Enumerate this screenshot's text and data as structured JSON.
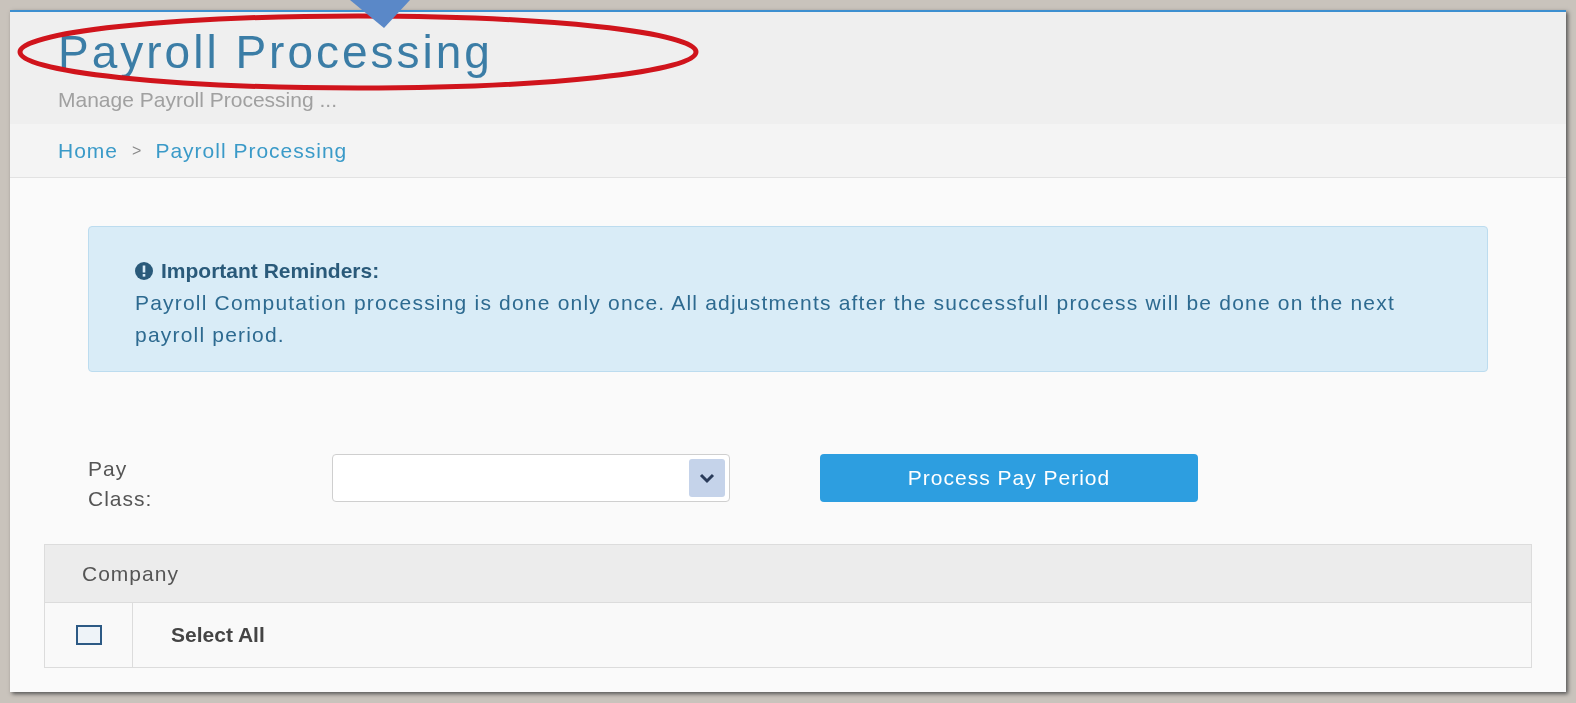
{
  "page_header": {
    "title": "Payroll Processing",
    "subtitle": "Manage Payroll Processing ..."
  },
  "breadcrumb": {
    "separator": ">",
    "items": [
      {
        "label": "Home"
      },
      {
        "label": "Payroll Processing"
      }
    ]
  },
  "alert": {
    "title": "Important Reminders:",
    "message": "Payroll Computation processing is done only once. All adjustments after the successfull process will be done on the next payroll period."
  },
  "form": {
    "label": "Pay Class:",
    "button": "Process Pay Period"
  },
  "table": {
    "column": "Company",
    "rows": [
      {
        "label": "Select All",
        "checked": false
      }
    ]
  }
}
